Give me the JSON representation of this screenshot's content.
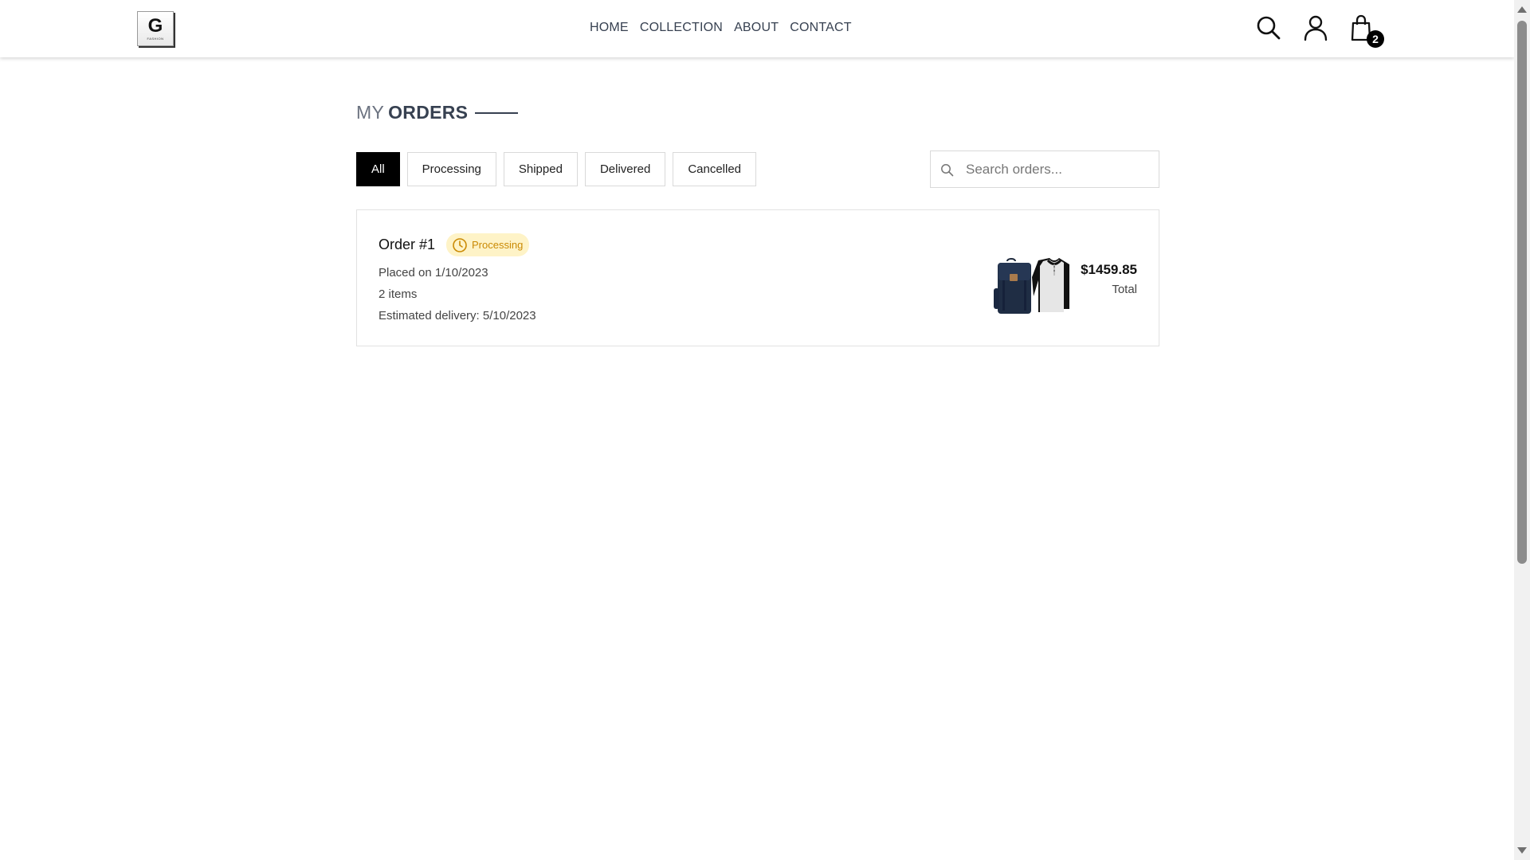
{
  "brand": {
    "logo_letter": "G",
    "logo_subtext": "FASHION"
  },
  "nav": {
    "home": "HOME",
    "collection": "COLLECTION",
    "about": "ABOUT",
    "contact": "CONTACT"
  },
  "header_icons": {
    "search": "search-icon",
    "profile": "user-icon",
    "cart": "shopping-bag-icon",
    "cart_count": "2"
  },
  "page": {
    "title_prefix": "MY",
    "title_main": "ORDERS"
  },
  "filters": [
    {
      "label": "All",
      "active": true
    },
    {
      "label": "Processing",
      "active": false
    },
    {
      "label": "Shipped",
      "active": false
    },
    {
      "label": "Delivered",
      "active": false
    },
    {
      "label": "Cancelled",
      "active": false
    }
  ],
  "search": {
    "placeholder": "Search orders..."
  },
  "orders": [
    {
      "title": "Order #1",
      "status": "Processing",
      "placed": "Placed on 1/10/2023",
      "items": "2 items",
      "delivery": "Estimated delivery: 5/10/2023",
      "price": "$1459.85",
      "total_label": "Total",
      "thumbnails": [
        "backpack",
        "raglan-shirt"
      ]
    }
  ],
  "colors": {
    "status_processing": "#ca8a04",
    "status_processing_bg": "#fef3c7",
    "active_filter": "#000000"
  }
}
